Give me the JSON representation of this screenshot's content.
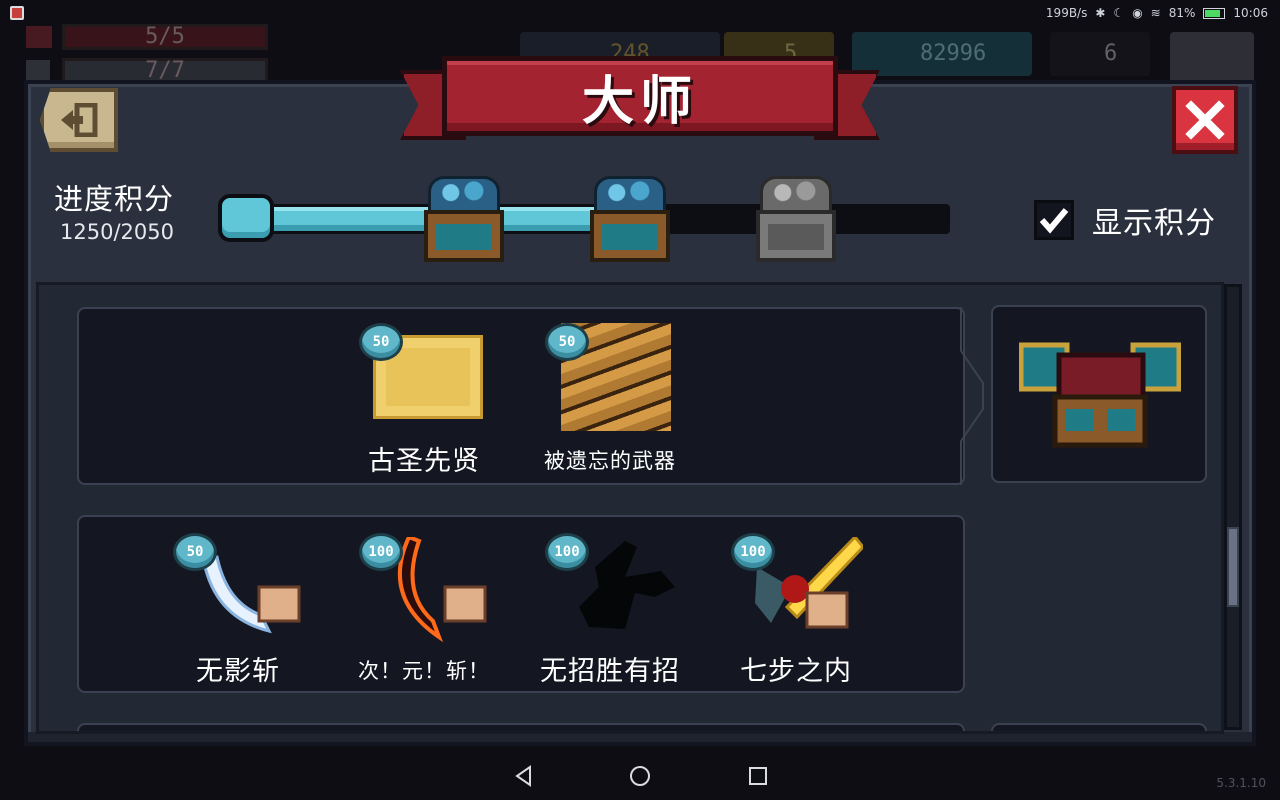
{
  "status_bar": {
    "net_speed": "199B/s",
    "battery": "81%",
    "battery_level": 0.81,
    "time": "10:06"
  },
  "hud": {
    "health": "5/5",
    "armor": "7/7",
    "coins": "248",
    "keys": "5",
    "gems": "82996",
    "energy": "6"
  },
  "title": "大师",
  "progress": {
    "label": "进度积分",
    "current": 1250,
    "max": 2050,
    "value_text": "1250/2050",
    "chests": [
      {
        "state": "unlocked"
      },
      {
        "state": "unlocked"
      },
      {
        "state": "locked"
      }
    ]
  },
  "show_score": {
    "label": "显示积分",
    "checked": true
  },
  "rows": [
    {
      "items": [
        {
          "badge": "50",
          "label": "古圣先贤",
          "icon": "ancient-sage-scroll-icon"
        },
        {
          "badge": "50",
          "label": "被遗忘的武器",
          "icon": "forgotten-weapon-icon"
        }
      ],
      "reward": {
        "icon": "reward-chest-icon"
      }
    },
    {
      "items": [
        {
          "badge": "50",
          "label": "无影斩",
          "icon": "shadowless-slash-icon"
        },
        {
          "badge": "100",
          "label": "次！元！斩！",
          "icon": "dimension-slash-icon"
        },
        {
          "badge": "100",
          "label": "无招胜有招",
          "icon": "no-move-icon"
        },
        {
          "badge": "100",
          "label": "七步之内",
          "icon": "seven-steps-icon"
        }
      ]
    }
  ],
  "version": "5.3.1.10",
  "colors": {
    "accent": "#5fc7d7",
    "banner": "#a32430",
    "panel": "#2a303d",
    "close": "#d9343f"
  }
}
